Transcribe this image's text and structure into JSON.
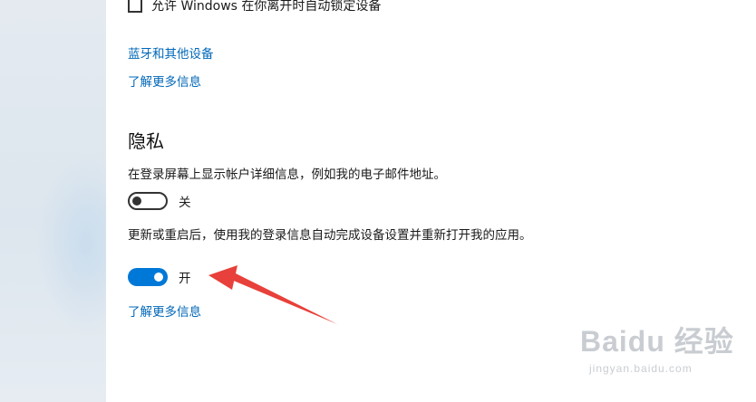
{
  "top_checkbox": {
    "label": "允许 Windows 在你离开时自动锁定设备",
    "checked": false
  },
  "links": {
    "bluetooth": "蓝牙和其他设备",
    "learn_more_1": "了解更多信息",
    "learn_more_2": "了解更多信息"
  },
  "privacy": {
    "title": "隐私",
    "setting1": {
      "description": "在登录屏幕上显示帐户详细信息，例如我的电子邮件地址。",
      "state_label": "关",
      "on": false
    },
    "setting2": {
      "description": "更新或重启后，使用我的登录信息自动完成设备设置并重新打开我的应用。",
      "state_label": "开",
      "on": true
    }
  },
  "watermark": {
    "main": "Baidu 经验",
    "sub": "jingyan.baidu.com"
  },
  "colors": {
    "accent": "#0078d7",
    "link": "#0067b8",
    "arrow": "#e8403a"
  }
}
